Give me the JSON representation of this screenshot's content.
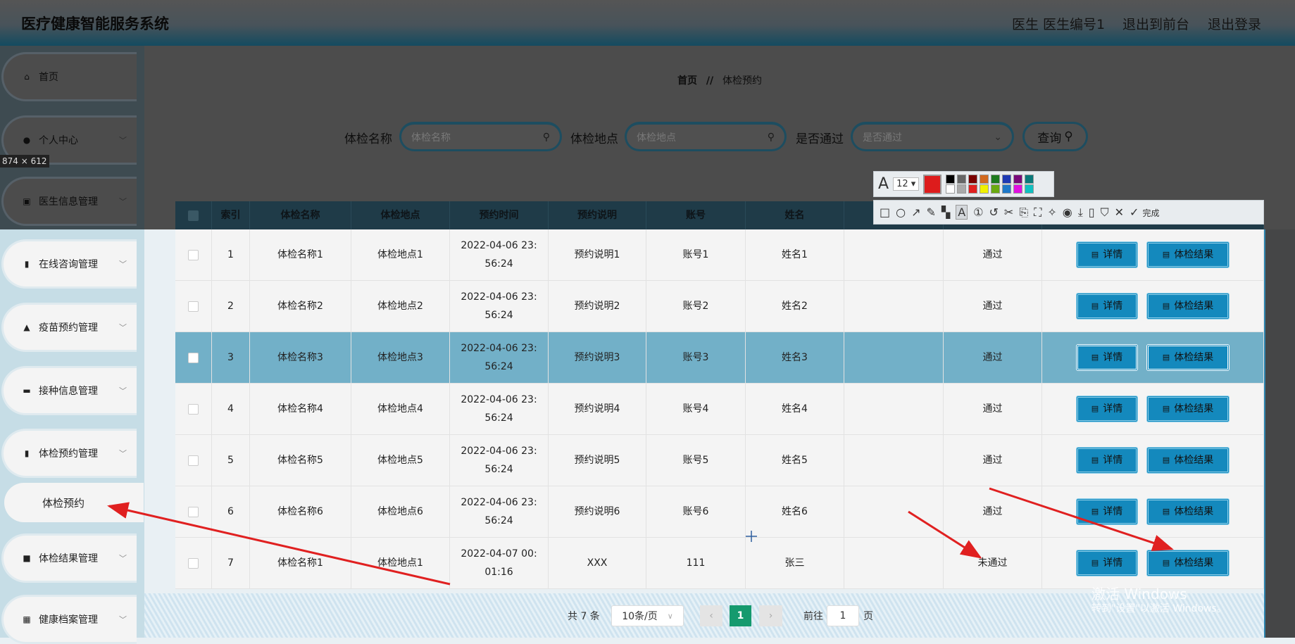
{
  "header": {
    "title": "医疗健康智能服务系统",
    "user": "医生 医生编号1",
    "to_front": "退出到前台",
    "logout": "退出登录"
  },
  "sidebar": {
    "items": [
      {
        "label": "首页",
        "icon": "home-icon",
        "glyph": "⌂"
      },
      {
        "label": "个人中心",
        "icon": "user-icon",
        "glyph": "●"
      },
      {
        "label": "医生信息管理",
        "icon": "clipboard-icon",
        "glyph": "▣"
      },
      {
        "label": "在线咨询管理",
        "icon": "book-icon",
        "glyph": "▮"
      },
      {
        "label": "疫苗预约管理",
        "icon": "stamp-icon",
        "glyph": "▲"
      },
      {
        "label": "接种信息管理",
        "icon": "briefcase-icon",
        "glyph": "▬"
      },
      {
        "label": "体检预约管理",
        "icon": "bar-chart-icon",
        "glyph": "▮"
      },
      {
        "label": "体检结果管理",
        "icon": "ticket-icon",
        "glyph": "■"
      },
      {
        "label": "健康档案管理",
        "icon": "grid-icon",
        "glyph": "▦"
      }
    ],
    "submenu": "体检预约"
  },
  "breadcrumb": {
    "home": "首页",
    "sep": "//",
    "current": "体检预约"
  },
  "search": {
    "name_label": "体检名称",
    "name_placeholder": "体检名称",
    "place_label": "体检地点",
    "place_placeholder": "体检地点",
    "pass_label": "是否通过",
    "pass_placeholder": "是否通过",
    "query": "查询"
  },
  "table": {
    "headers": [
      "",
      "索引",
      "体检名称",
      "体检地点",
      "预约时间",
      "预约说明",
      "账号",
      "姓名",
      "",
      "",
      ""
    ],
    "rows": [
      [
        "1",
        "体检名称1",
        "体检地点1",
        "2022-04-06 23:56:24",
        "预约说明1",
        "账号1",
        "姓名1",
        "",
        "通过"
      ],
      [
        "2",
        "体检名称2",
        "体检地点2",
        "2022-04-06 23:56:24",
        "预约说明2",
        "账号2",
        "姓名2",
        "",
        "通过"
      ],
      [
        "3",
        "体检名称3",
        "体检地点3",
        "2022-04-06 23:56:24",
        "预约说明3",
        "账号3",
        "姓名3",
        "",
        "通过"
      ],
      [
        "4",
        "体检名称4",
        "体检地点4",
        "2022-04-06 23:56:24",
        "预约说明4",
        "账号4",
        "姓名4",
        "",
        "通过"
      ],
      [
        "5",
        "体检名称5",
        "体检地点5",
        "2022-04-06 23:56:24",
        "预约说明5",
        "账号5",
        "姓名5",
        "",
        "通过"
      ],
      [
        "6",
        "体检名称6",
        "体检地点6",
        "2022-04-06 23:56:24",
        "预约说明6",
        "账号6",
        "姓名6",
        "",
        "通过"
      ],
      [
        "7",
        "体检名称1",
        "体检地点1",
        "2022-04-07 00:01:16",
        "XXX",
        "111",
        "张三",
        "",
        "未通过"
      ]
    ],
    "detail": "详情",
    "result": "体检结果"
  },
  "pagination": {
    "total": "共 7 条",
    "page_size": "10条/页",
    "current": "1",
    "goto": "前往",
    "goto_value": "1",
    "page_unit": "页"
  },
  "toolbar": {
    "font_size": "12",
    "done": "完成",
    "colors": [
      "#000000",
      "#666666",
      "#7a0000",
      "#d2691e",
      "#1e7a1e",
      "#1e3ab4",
      "#7a0a7a",
      "#0a7a7a",
      "#ffffff",
      "#aaaaaa",
      "#e02020",
      "#f0f000",
      "#6aaa10",
      "#1e78c8",
      "#e010e0",
      "#10c0c0"
    ],
    "selected_color": "#dd1c1c"
  },
  "overlay": {
    "dimension": "874 × 612"
  },
  "watermark": {
    "line1": "激活 Windows",
    "line2": "转到\"设置\"以激活 Windows。"
  }
}
